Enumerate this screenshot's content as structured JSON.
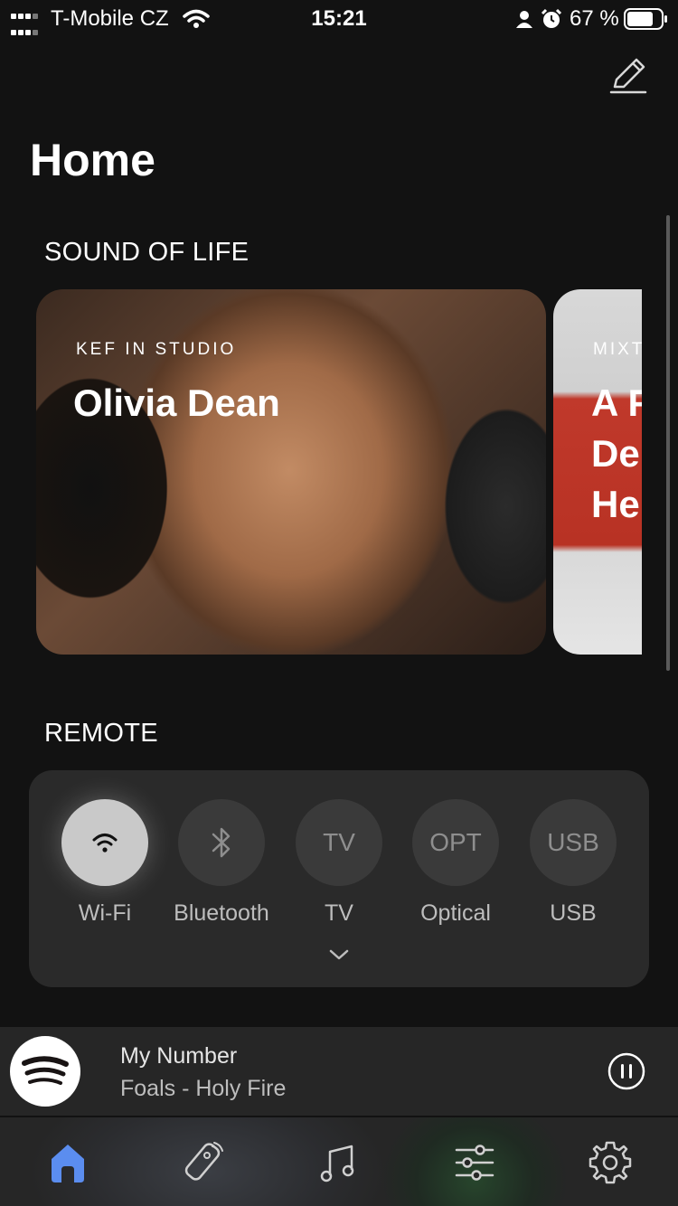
{
  "status_bar": {
    "carrier": "T-Mobile CZ",
    "time": "15:21",
    "battery_percent": "67 %"
  },
  "header": {
    "title": "Home"
  },
  "sound_of_life": {
    "title": "SOUND OF LIFE",
    "cards": [
      {
        "eyebrow": "KEF IN STUDIO",
        "headline": "Olivia Dean"
      },
      {
        "eyebrow": "MIXT",
        "headline_lines": [
          "A F",
          "De",
          "He"
        ]
      }
    ]
  },
  "remote": {
    "title": "REMOTE",
    "sources": [
      {
        "label": "Wi-Fi",
        "icon": "wifi-icon",
        "active": true
      },
      {
        "label": "Bluetooth",
        "icon": "bluetooth-icon",
        "active": false
      },
      {
        "label": "TV",
        "icon_text": "TV",
        "active": false
      },
      {
        "label": "Optical",
        "icon_text": "OPT",
        "active": false
      },
      {
        "label": "USB",
        "icon_text": "USB",
        "active": false
      }
    ]
  },
  "now_playing": {
    "track": "My Number",
    "artist_album": "Foals - Holy Fire",
    "service_icon": "spotify-icon"
  },
  "tab_bar": {
    "items": [
      "home-icon",
      "remote-icon",
      "music-note-icon",
      "equalizer-icon",
      "gear-icon"
    ],
    "active_color": "#5b8def"
  }
}
